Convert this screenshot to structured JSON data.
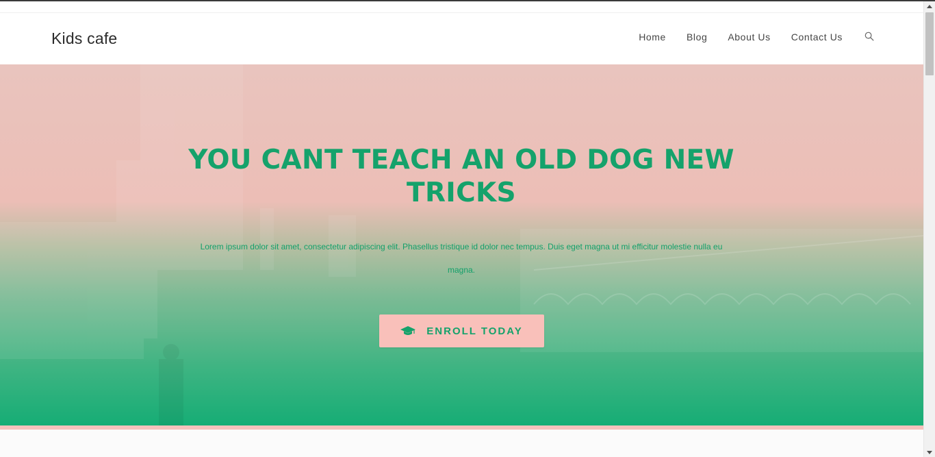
{
  "site": {
    "logo": "Kids cafe"
  },
  "nav": {
    "items": [
      "Home",
      "Blog",
      "About Us",
      "Contact Us"
    ],
    "search_icon": "search-icon"
  },
  "hero": {
    "title": "YOU CANT TEACH AN OLD DOG NEW TRICKS",
    "text": "Lorem ipsum dolor sit amet, consectetur adipiscing elit. Phasellus tristique id dolor nec tempus. Duis eget magna ut mi efficitur molestie nulla eu magna.",
    "button_label": "ENROLL TODAY",
    "button_icon": "graduation-cap-icon"
  },
  "colors": {
    "accent": "#15a26b",
    "button_bg": "#f9c0ba",
    "gradient_top": "#e9c4be",
    "gradient_bottom": "#16ad75"
  }
}
